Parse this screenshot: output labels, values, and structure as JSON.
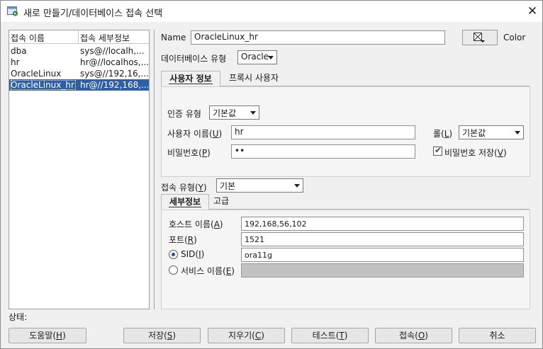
{
  "window": {
    "title": "새로 만들기/데이터베이스 접속 선택",
    "app_icon": "database-connect-icon",
    "close_icon": "close-icon"
  },
  "connections": {
    "headers": [
      "접속 이름",
      "접속 세부정보"
    ],
    "rows": [
      {
        "name": "dba",
        "details": "sys@//localh,..."
      },
      {
        "name": "hr",
        "details": "hr@//localhos,..."
      },
      {
        "name": "OracleLinux",
        "details": "sys@//192,16,..."
      },
      {
        "name": "OracleLinux_hr",
        "details": "hr@//192,168,...",
        "selected": true
      }
    ]
  },
  "form": {
    "name_label": "Name",
    "name_value": "OracleLinux_hr",
    "color_label": "Color",
    "color_icon": "color-picker-icon",
    "db_type_label": "데이터베이스 유형",
    "db_type_value": "Oracle",
    "user_tabs": [
      {
        "label": "사용자 정보",
        "active": true
      },
      {
        "label": "프록시 사용자",
        "active": false
      }
    ],
    "auth_type_label": "인증 유형",
    "auth_type_value": "기본값",
    "username_label_pre": "사용자 이름(",
    "username_label_key": "U",
    "username_label_post": ")",
    "username_value": "hr",
    "role_label_pre": "롤(",
    "role_label_key": "L",
    "role_label_post": ")",
    "role_value": "기본값",
    "password_label_pre": "비밀번호(",
    "password_label_key": "P",
    "password_label_post": ")",
    "password_value": "••",
    "save_password_label_pre": "비밀번호 저장(",
    "save_password_label_key": "V",
    "save_password_label_post": ")",
    "save_password_checked": true,
    "conn_type_label_pre": "접속 유형(",
    "conn_type_label_key": "Y",
    "conn_type_label_post": ")",
    "conn_type_value": "기본",
    "detail_tabs": [
      {
        "label": "세부정보",
        "active": true
      },
      {
        "label": "고급",
        "active": false
      }
    ],
    "host_label_pre": "호스트 이름(",
    "host_label_key": "A",
    "host_label_post": ")",
    "host_value": "192,168,56,102",
    "port_label_pre": "포트(",
    "port_label_key": "R",
    "port_label_post": ")",
    "port_value": "1521",
    "sid_label_pre": "SID(",
    "sid_label_key": "I",
    "sid_label_post": ")",
    "sid_value": "ora11g",
    "service_label_pre": "서비스 이름(",
    "service_label_key": "E",
    "service_label_post": ")",
    "service_value": "",
    "selected_radio": "sid"
  },
  "status_label": "상태:",
  "buttons": {
    "help": {
      "pre": "도움말(",
      "key": "H",
      "post": ")"
    },
    "save": {
      "pre": "저장(",
      "key": "S",
      "post": ")"
    },
    "clear": {
      "pre": "지우기(",
      "key": "C",
      "post": ")"
    },
    "test": {
      "pre": "테스트(",
      "key": "T",
      "post": ")"
    },
    "connect": {
      "pre": "접속(",
      "key": "O",
      "post": ")"
    },
    "cancel": {
      "label": "취소"
    }
  }
}
